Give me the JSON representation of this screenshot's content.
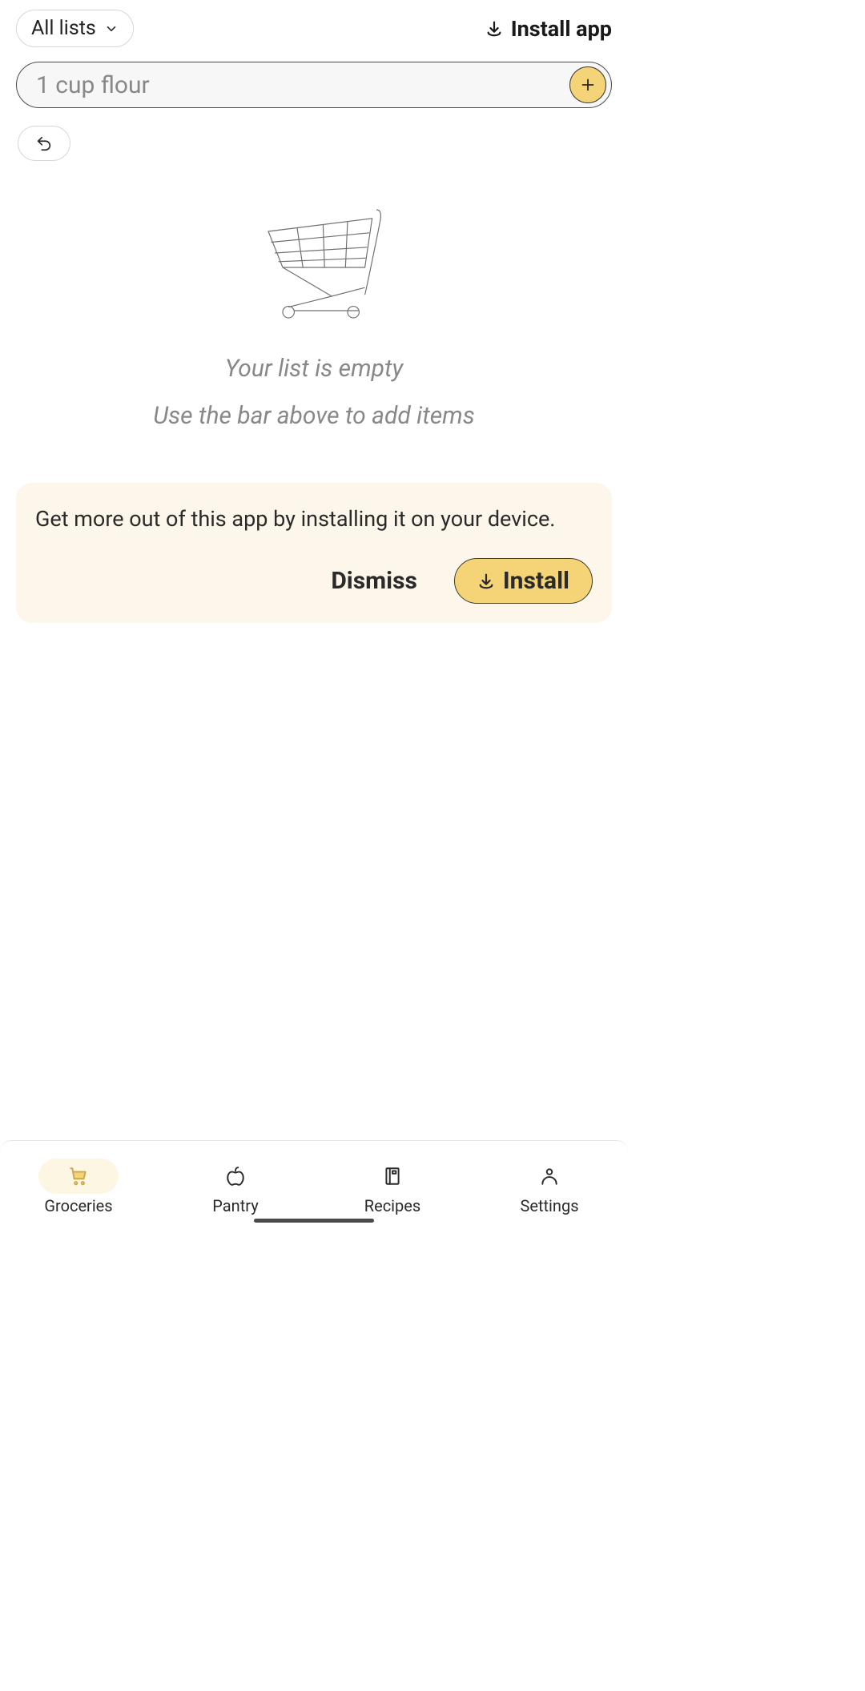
{
  "header": {
    "list_selector_label": "All lists",
    "install_app_label": "Install app"
  },
  "input": {
    "placeholder": "1 cup flour"
  },
  "empty_state": {
    "title": "Your list is empty",
    "subtitle": "Use the bar above to add items"
  },
  "install_banner": {
    "text": "Get more out of this app by installing it on your device.",
    "dismiss_label": "Dismiss",
    "install_label": "Install"
  },
  "tabs": [
    {
      "label": "Groceries",
      "active": true
    },
    {
      "label": "Pantry",
      "active": false
    },
    {
      "label": "Recipes",
      "active": false
    },
    {
      "label": "Settings",
      "active": false
    }
  ],
  "colors": {
    "accent": "#f5d477",
    "banner_bg": "#fdf6ea",
    "muted": "#888888"
  }
}
